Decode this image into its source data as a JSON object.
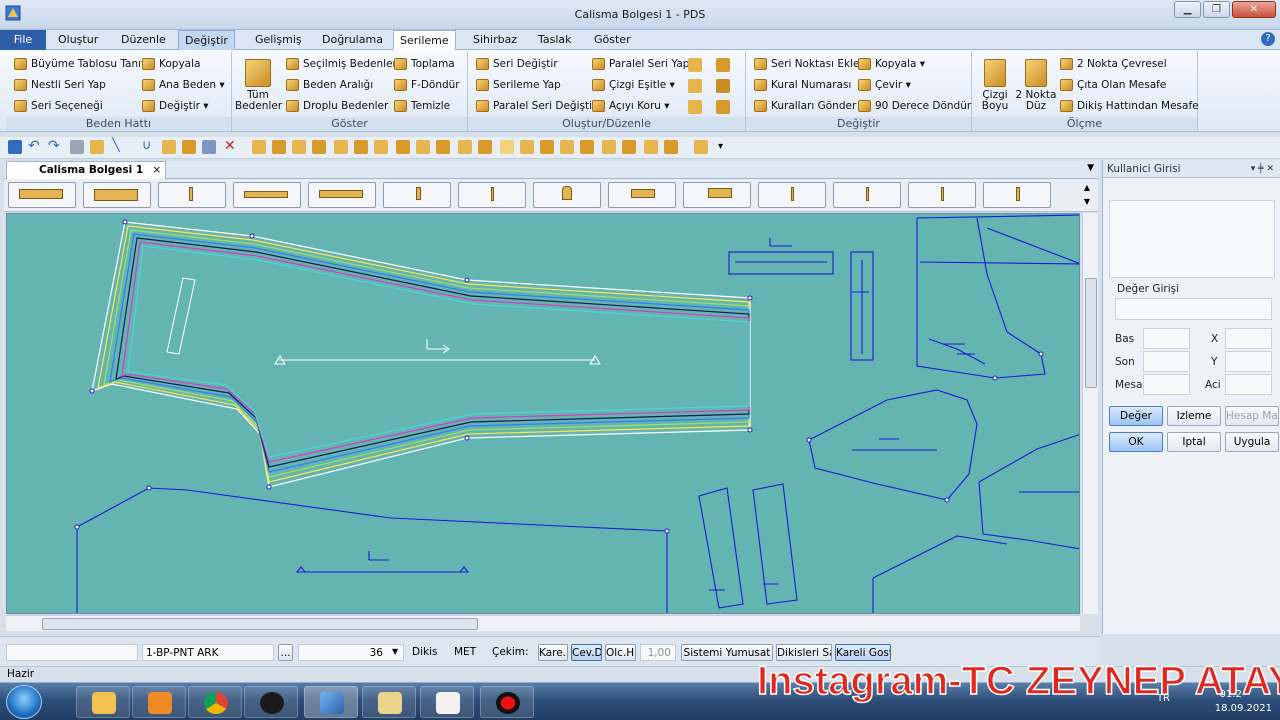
{
  "window": {
    "title": "Calisma Bolgesi 1 - PDS"
  },
  "menu": {
    "items": [
      "File",
      "Oluştur",
      "Düzenle",
      "Değiştir",
      "Gelişmiş",
      "Doğrulama",
      "Serileme",
      "Sihirbaz",
      "Taslak",
      "Göster"
    ],
    "active": "Serileme",
    "highlighted": "Değiştir"
  },
  "ribbon": {
    "beden_hatti": {
      "label": "Beden Hattı",
      "items": [
        "Büyüme Tablosu Tanıt",
        "Kopyala",
        "Nestli Seri Yap",
        "Ana Beden ▾",
        "Seri Seçeneği",
        "Değiştir ▾"
      ]
    },
    "goster": {
      "label": "Göster",
      "big": "Tüm Bedenler",
      "items": [
        "Seçilmiş Bedenler",
        "Toplama",
        "Beden Aralığı",
        "F-Döndür",
        "Droplu Bedenler",
        "Temizle"
      ]
    },
    "olustur": {
      "label": "Oluştur/Düzenle",
      "items": [
        "Seri Değiştir",
        "Paralel Seri Yap",
        "Serileme Yap",
        "Çizgi Eşitle ▾",
        "Paralel Seri Değiştir",
        "Açıyı Koru ▾"
      ]
    },
    "degistir": {
      "label": "Değiştir",
      "items": [
        "Seri Noktası Ekle",
        "Kopyala ▾",
        "Kural Numarası",
        "Çevir ▾",
        "Kuralları Gönder",
        "90 Derece Döndür"
      ]
    },
    "olcme": {
      "label": "Ölçme",
      "big1": "Çizgi Boyu",
      "big2": "2 Nokta Düz",
      "items": [
        "2 Nokta Çevresel",
        "Çıta Olan Mesafe",
        "Dikiş Hattından Mesafe"
      ]
    }
  },
  "tab": {
    "label": "Calisma Bolgesi 1",
    "close": "×"
  },
  "panel": {
    "title": "Kullanici Girisi",
    "deger_girisi": "Değer Girişi",
    "labels": {
      "bas": "Bas",
      "son": "Son",
      "mesafe": "Mesa",
      "x": "X",
      "y": "Y",
      "aci": "Aci"
    },
    "buttons": {
      "deger": "Değer",
      "izleme": "Izleme",
      "hesap": "Hesap Mak",
      "ok": "OK",
      "iptal": "Iptal",
      "uygula": "Uygula"
    }
  },
  "status": {
    "piece_name": "1-BP-PNT ARK",
    "more": "...",
    "size": "36",
    "dikis": "Dikis",
    "unit": "MET",
    "cekim": "Çekim:",
    "btn1": "Kare.D",
    "btn2": "Cev.D",
    "btn3": "Olc.H.",
    "value": "1,00",
    "btn4": "Sistemi Yumusat",
    "btn5": "Dikisleri Sakla",
    "btn6": "Kareli Goster",
    "ready": "Hazir"
  },
  "taskbar": {
    "time": "01:2",
    "date": "18.09.2021",
    "lang": "TR"
  },
  "watermark": "Instagram-TC ZEYNEP ATAY"
}
